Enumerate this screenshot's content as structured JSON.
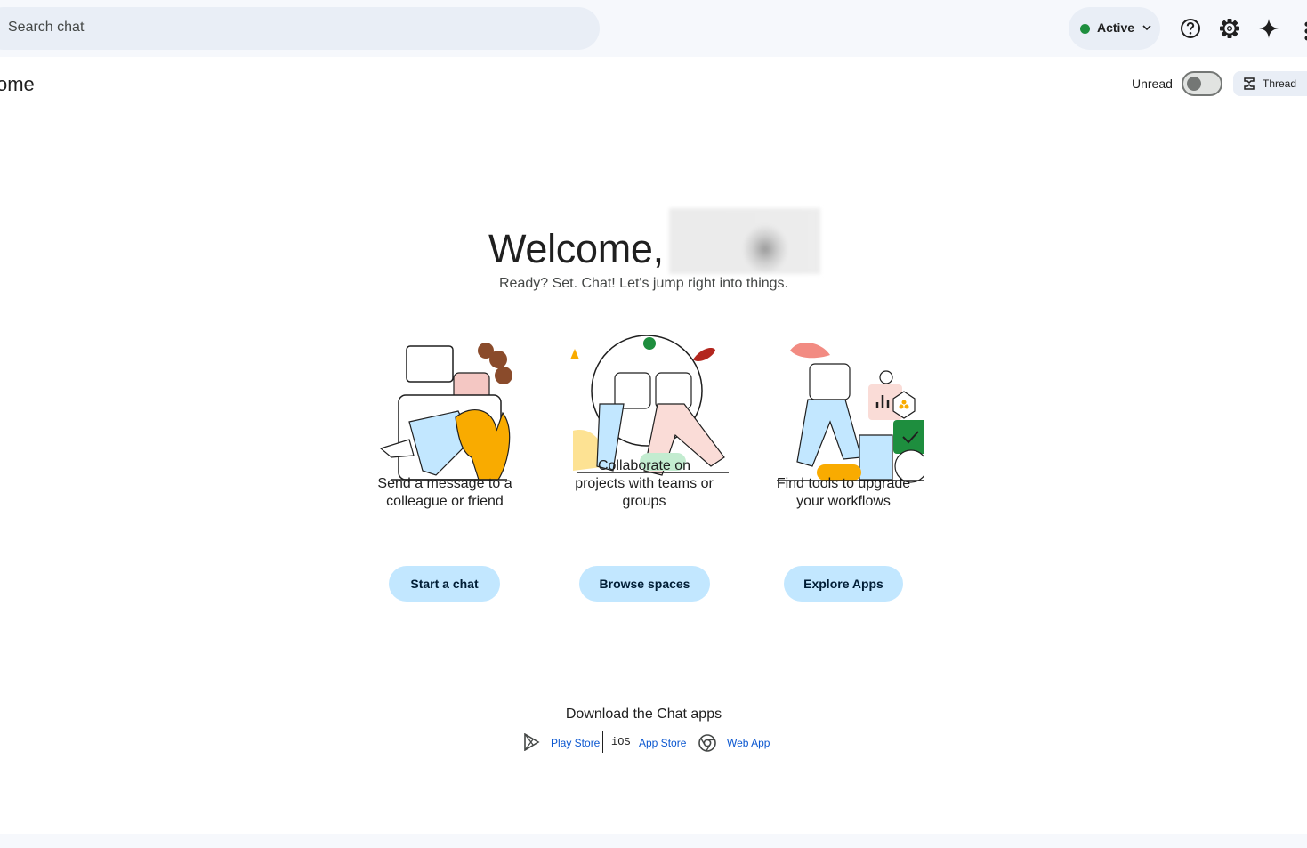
{
  "search": {
    "placeholder": "Search chat"
  },
  "status": {
    "label": "Active",
    "color": "#1e8e3e"
  },
  "toolbar": {
    "icons": [
      "help-icon",
      "settings-icon",
      "gemini-sparkle-icon",
      "apps-grid-icon"
    ]
  },
  "header": {
    "title": "ome",
    "unread_label": "Unread",
    "thread_label": "Thread"
  },
  "welcome": {
    "greeting": "Welcome,",
    "subtitle": "Ready? Set. Chat! Let's jump right into things."
  },
  "cards": [
    {
      "description_lines": [
        "Send a message to a",
        "colleague or friend"
      ],
      "button": "Start a chat"
    },
    {
      "description_lines": [
        "Collaborate on",
        "projects with teams or",
        "groups"
      ],
      "button": "Browse spaces"
    },
    {
      "description_lines": [
        "Find tools to upgrade",
        "your workflows"
      ],
      "button": "Explore Apps"
    }
  ],
  "download": {
    "title": "Download the Chat apps",
    "play_store": "Play Store",
    "ios_label": "iOS",
    "app_store": "App Store",
    "web_app": "Web App"
  },
  "colors": {
    "accent_button": "#c2e7ff",
    "link": "#0b57d0",
    "background": "#f6f8fc"
  }
}
